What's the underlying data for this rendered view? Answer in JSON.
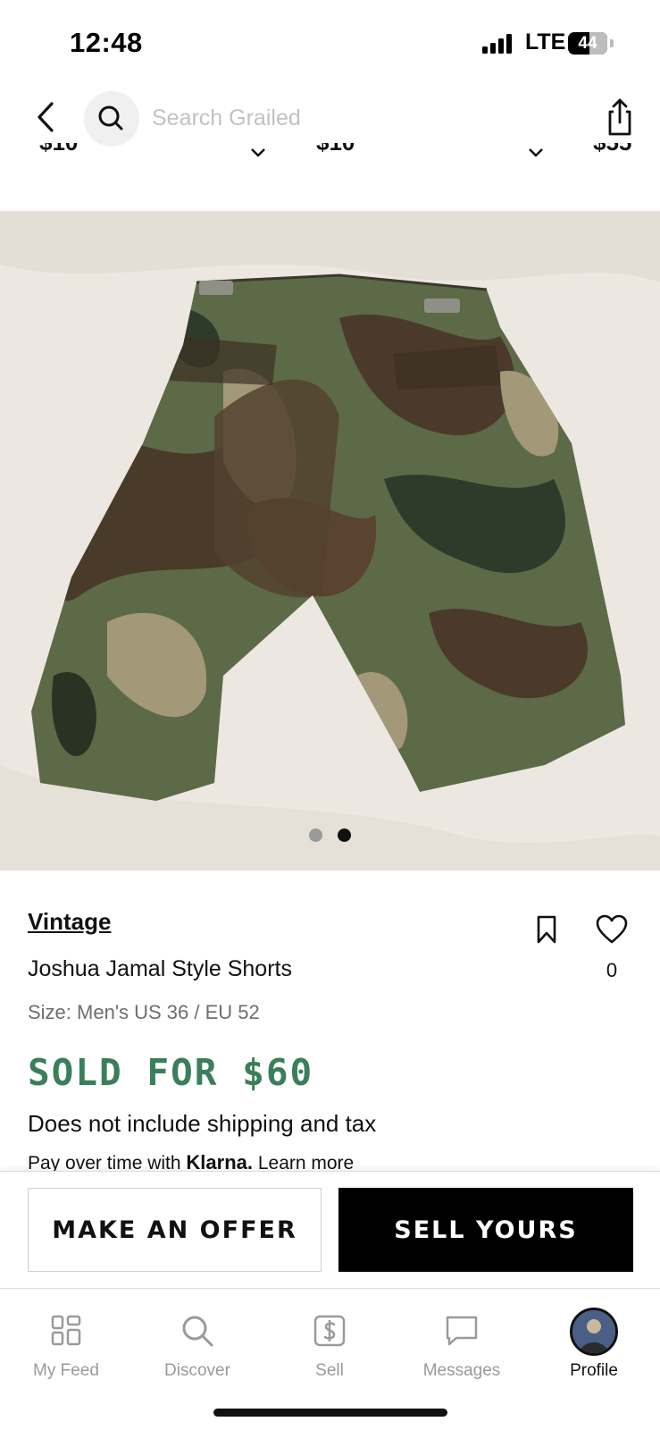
{
  "status_bar": {
    "time": "12:48",
    "network": "LTE",
    "battery": "44"
  },
  "header": {
    "search_placeholder": "Search Grailed"
  },
  "cropped_row": {
    "prices": [
      "$10",
      "$10",
      "$55"
    ]
  },
  "carousel": {
    "count": 2,
    "active_index": 1
  },
  "listing": {
    "brand": "Vintage",
    "title": "Joshua Jamal Style Shorts",
    "size": "Size: Men's US 36 / EU 52",
    "sold_price": "SOLD FOR $60",
    "shipping_note": "Does not include shipping and tax",
    "klarna_prefix": "Pay over time with",
    "klarna_brand": "Klarna.",
    "klarna_link": "Learn more",
    "like_count": "0"
  },
  "actions": {
    "offer_label": "MAKE AN OFFER",
    "sell_label": "SELL YOURS"
  },
  "tabs": [
    {
      "label": "My Feed",
      "icon": "feed-grid-icon"
    },
    {
      "label": "Discover",
      "icon": "search-icon"
    },
    {
      "label": "Sell",
      "icon": "dollar-tag-icon"
    },
    {
      "label": "Messages",
      "icon": "message-bubble-icon"
    },
    {
      "label": "Profile",
      "icon": "avatar"
    }
  ],
  "colors": {
    "sold_green": "#3b7f5a",
    "active_dot": "#111111",
    "inactive_dot": "#9a9a9a",
    "primary_button": "#000000"
  }
}
